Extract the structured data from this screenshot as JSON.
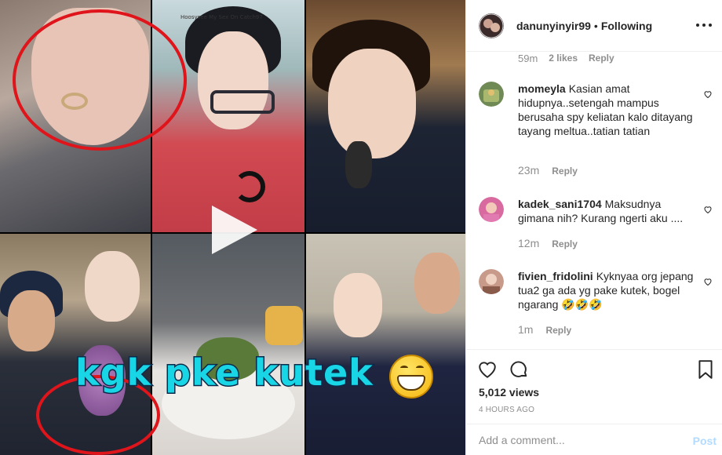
{
  "post": {
    "username": "danunyinyir99",
    "separator": "•",
    "follow_status": "Following"
  },
  "media": {
    "overlay_text": "kgk pke kutek",
    "small_caption": "Hoosysee My Sex On Catch97"
  },
  "partial_comment": {
    "time": "59m",
    "likes": "2 likes",
    "reply": "Reply"
  },
  "comments": [
    {
      "username": "momeyla",
      "text": "Kasian amat hidupnya..setengah mampus berusaha spy keliatan kalo ditayang tayang meltua..tatian tatian",
      "time": "23m",
      "reply": "Reply"
    },
    {
      "username": "kadek_sani1704",
      "text": "Maksudnya gimana nih? Kurang ngerti aku ....",
      "time": "12m",
      "reply": "Reply"
    },
    {
      "username": "fivien_fridolini",
      "text": "Kyknyaa org jepang tua2 ga ada yg pake kutek, bogel ngarang 🤣🤣🤣",
      "time": "1m",
      "reply": "Reply"
    }
  ],
  "stats": {
    "views": "5,012 views",
    "posted": "4 HOURS AGO"
  },
  "add_comment": {
    "placeholder": "Add a comment...",
    "post_label": "Post"
  },
  "icons": {
    "like": "heart-outline-icon",
    "comment": "speech-bubble-icon",
    "save": "bookmark-icon",
    "more": "ellipsis-icon",
    "play": "play-icon"
  },
  "colors": {
    "text": "#262626",
    "muted": "#8e8e8e",
    "divider": "#efefef",
    "post_disabled": "#b3dbff",
    "overlay_text": "#19d6e6",
    "highlight_circle": "#e0141b"
  }
}
